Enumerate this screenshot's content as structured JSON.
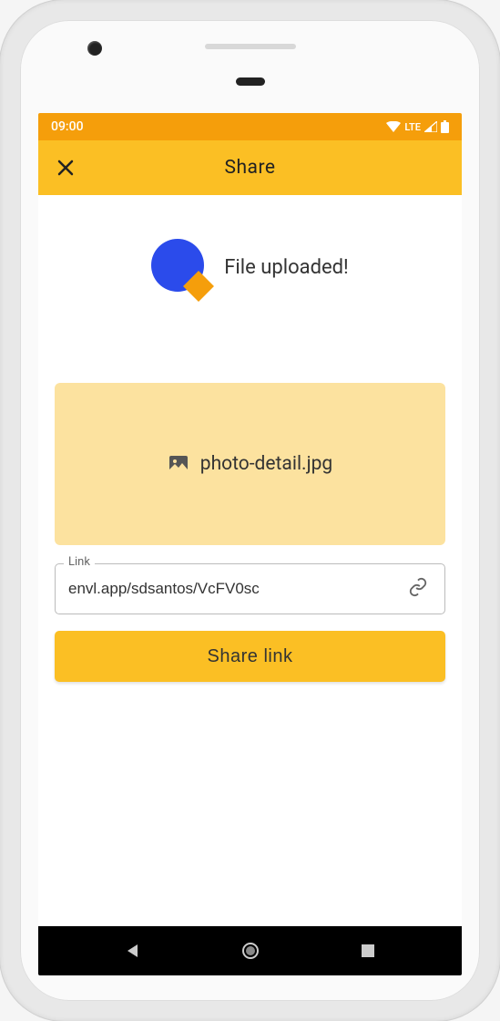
{
  "status_bar": {
    "time": "09:00",
    "network": "LTE"
  },
  "app_bar": {
    "title": "Share"
  },
  "upload": {
    "status_text": "File uploaded!"
  },
  "file": {
    "name": "photo-detail.jpg"
  },
  "link_field": {
    "label": "Link",
    "value": "envl.app/sdsantos/VcFV0sc"
  },
  "share_button": {
    "label": "Share link"
  }
}
